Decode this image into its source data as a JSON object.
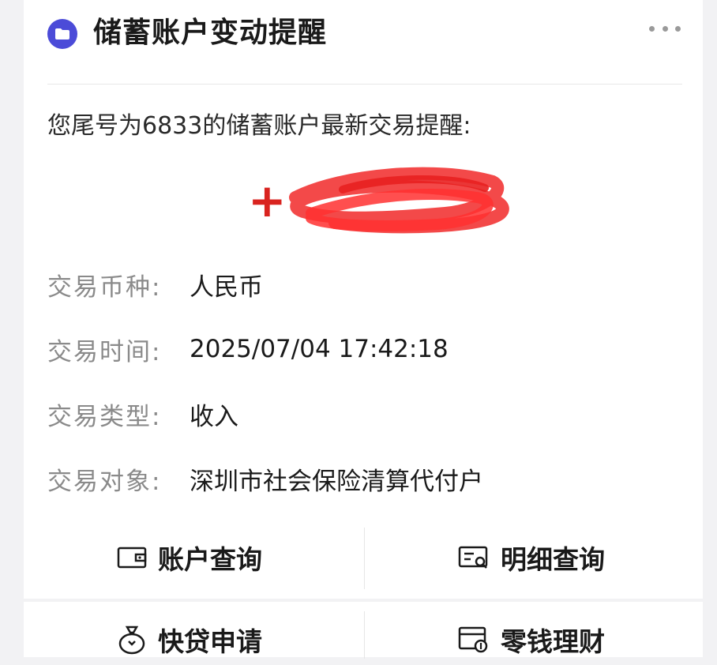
{
  "header": {
    "title": "储蓄账户变动提醒"
  },
  "notice": "您尾号为6833的储蓄账户最新交易提醒:",
  "amount": "+",
  "details": [
    {
      "label": "交易币种:",
      "value": "人民币"
    },
    {
      "label": "交易时间:",
      "value": "2025/07/04 17:42:18"
    },
    {
      "label": "交易类型:",
      "value": "收入"
    },
    {
      "label": "交易对象:",
      "value": "深圳市社会保险清算代付户"
    }
  ],
  "actions": {
    "account_query": "账户查询",
    "detail_query": "明细查询",
    "quick_loan": "快贷申请",
    "wealth": "零钱理财"
  },
  "colors": {
    "accent": "#4b4bd8",
    "amount": "#d9231f",
    "label": "#8a8a8a"
  }
}
